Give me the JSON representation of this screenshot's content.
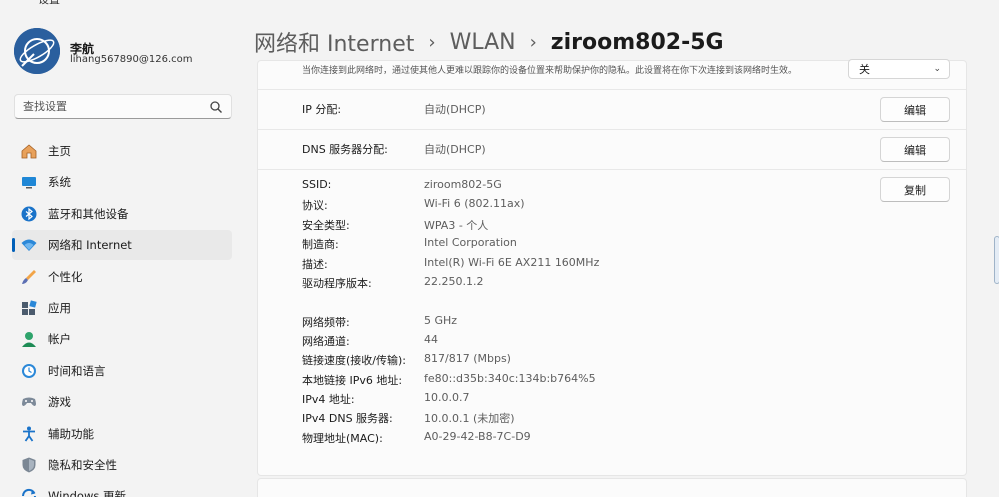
{
  "window": {
    "title": "设置"
  },
  "user": {
    "name": "李航",
    "email": "lihang567890@126.com"
  },
  "search": {
    "placeholder": "查找设置"
  },
  "sidebar": {
    "items": [
      {
        "label": "主页",
        "icon": "home-icon"
      },
      {
        "label": "系统",
        "icon": "system-icon"
      },
      {
        "label": "蓝牙和其他设备",
        "icon": "bluetooth-icon"
      },
      {
        "label": "网络和 Internet",
        "icon": "network-icon",
        "active": true
      },
      {
        "label": "个性化",
        "icon": "brush-icon"
      },
      {
        "label": "应用",
        "icon": "apps-icon"
      },
      {
        "label": "帐户",
        "icon": "account-icon"
      },
      {
        "label": "时间和语言",
        "icon": "time-language-icon"
      },
      {
        "label": "游戏",
        "icon": "gaming-icon"
      },
      {
        "label": "辅助功能",
        "icon": "accessibility-icon"
      },
      {
        "label": "隐私和安全性",
        "icon": "shield-icon"
      },
      {
        "label": "Windows 更新",
        "icon": "update-icon"
      }
    ]
  },
  "breadcrumb": {
    "items": [
      "网络和 Internet",
      "WLAN"
    ],
    "current": "ziroom802-5G"
  },
  "privacy": {
    "description": "当你连接到此网络时，通过使其他人更难以跟踪你的设备位置来帮助保护你的隐私。此设置将在你下次连接到该网络时生效。",
    "select_value": "关"
  },
  "ip_assignment": {
    "label": "IP 分配:",
    "value": "自动(DHCP)",
    "button": "编辑"
  },
  "dns_assignment": {
    "label": "DNS 服务器分配:",
    "value": "自动(DHCP)",
    "button": "编辑"
  },
  "properties": {
    "copy_button": "复制",
    "rows": [
      {
        "label": "SSID:",
        "value": "ziroom802-5G"
      },
      {
        "label": "协议:",
        "value": "Wi-Fi 6 (802.11ax)"
      },
      {
        "label": "安全类型:",
        "value": "WPA3 - 个人"
      },
      {
        "label": "制造商:",
        "value": "Intel Corporation"
      },
      {
        "label": "描述:",
        "value": "Intel(R) Wi-Fi 6E AX211 160MHz"
      },
      {
        "label": "驱动程序版本:",
        "value": "22.250.1.2"
      },
      {
        "label": "网络频带:",
        "value": "5 GHz"
      },
      {
        "label": "网络通道:",
        "value": "44"
      },
      {
        "label": "链接速度(接收/传输):",
        "value": "817/817 (Mbps)"
      },
      {
        "label": "本地链接 IPv6 地址:",
        "value": "fe80::d35b:340c:134b:b764%5"
      },
      {
        "label": "IPv4 地址:",
        "value": "10.0.0.7"
      },
      {
        "label": "IPv4 DNS 服务器:",
        "value": "10.0.0.1 (未加密)"
      },
      {
        "label": "物理地址(MAC):",
        "value": "A0-29-42-B8-7C-D9"
      }
    ]
  }
}
